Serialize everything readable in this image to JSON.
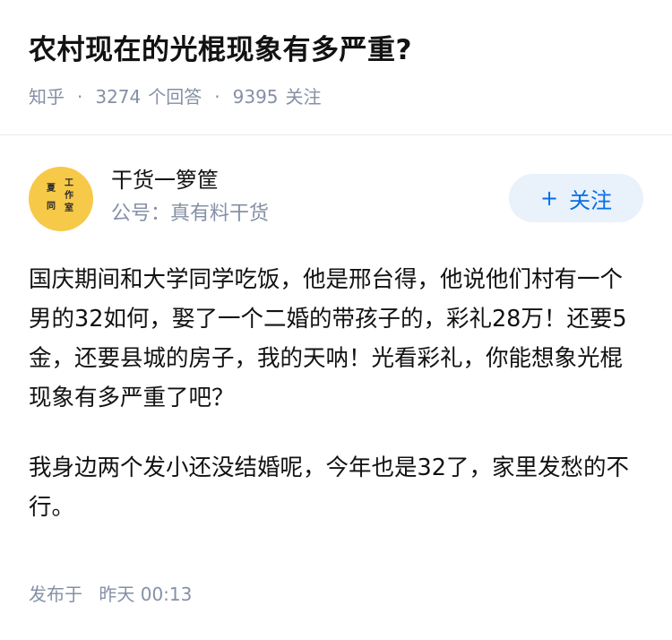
{
  "question": {
    "title": "农村现在的光棍现象有多严重?",
    "source": "知乎",
    "answers_count": "3274",
    "answers_label": "个回答",
    "followers_count": "9395",
    "followers_label": "关注",
    "separator": "·"
  },
  "author": {
    "name": "干货一箩筐",
    "description": "公号：真有料干货",
    "avatar_chars": [
      "夏",
      "工",
      "作",
      "同",
      "室"
    ],
    "avatar_color": "#f7c948"
  },
  "follow_button": {
    "icon": "+",
    "label": "关注",
    "color": "#056de8",
    "background": "#e9f1fb"
  },
  "answer": {
    "paragraphs": [
      "国庆期间和大学同学吃饭，他是邢台得，他说他们村有一个男的32如何，娶了一个二婚的带孩子的，彩礼28万！还要5金，还要县城的房子，我的天呐！光看彩礼，你能想象光棍现象有多严重了吧？",
      "我身边两个发小还没结婚呢，今年也是32了，家里发愁的不行。"
    ],
    "published_label": "发布于",
    "published_time": "昨天 00:13"
  },
  "colors": {
    "meta_gray": "#8590a6",
    "text": "#121212"
  }
}
